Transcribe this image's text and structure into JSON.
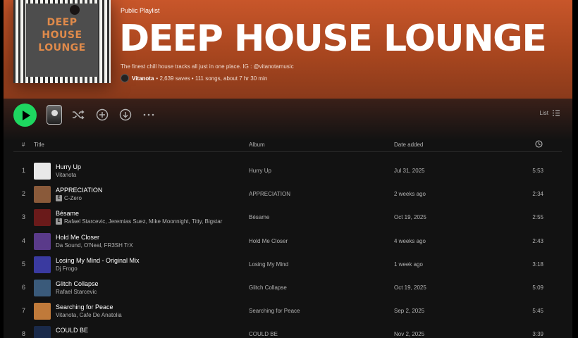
{
  "playlist": {
    "type_label": "Public Playlist",
    "title": "DEEP HOUSE LOUNGE",
    "description": "The finest chill house tracks all just in one place. IG : @vitanotamusic",
    "owner": "Vitanota",
    "stats": "• 2,639 saves • 111 songs, about 7 hr 30 min",
    "cover_lines": [
      "DEEP",
      "HOUSE",
      "LOUNGE"
    ]
  },
  "actions": {
    "view_label": "List"
  },
  "table": {
    "headers": {
      "index": "#",
      "title": "Title",
      "album": "Album",
      "date": "Date added"
    },
    "rows": [
      {
        "index": "1",
        "title": "Hurry Up",
        "artist": "Vitanota",
        "explicit": false,
        "album": "Hurry Up",
        "date": "Jul 31, 2025",
        "duration": "5:53",
        "thumb": "#e9e9e9"
      },
      {
        "index": "2",
        "title": "APPRECIATION",
        "artist": "C-Zero",
        "explicit": true,
        "album": "APPRECIATION",
        "date": "2 weeks ago",
        "duration": "2:34",
        "thumb": "#8a5a3a"
      },
      {
        "index": "3",
        "title": "Bésame",
        "artist": "Rafael Starcevic, Jeremias Suez, Mike Moonnight, Titty, Bigstar",
        "explicit": true,
        "album": "Bésame",
        "date": "Oct 19, 2025",
        "duration": "2:55",
        "thumb": "#6a1a1a"
      },
      {
        "index": "4",
        "title": "Hold Me Closer",
        "artist": "Da Sound, O'Neal, FR3SH TrX",
        "explicit": false,
        "album": "Hold Me Closer",
        "date": "4 weeks ago",
        "duration": "2:43",
        "thumb": "#5a3a8a"
      },
      {
        "index": "5",
        "title": "Losing My Mind - Original Mix",
        "artist": "Dj Frogo",
        "explicit": false,
        "album": "Losing My Mind",
        "date": "1 week ago",
        "duration": "3:18",
        "thumb": "#3a3aa0"
      },
      {
        "index": "6",
        "title": "Glitch Collapse",
        "artist": "Rafael Starcevic",
        "explicit": false,
        "album": "Glitch Collapse",
        "date": "Oct 19, 2025",
        "duration": "5:09",
        "thumb": "#3a5a7a"
      },
      {
        "index": "7",
        "title": "Searching for Peace",
        "artist": "Vitanota, Cafe De Anatolia",
        "explicit": false,
        "album": "Searching for Peace",
        "date": "Sep 2, 2025",
        "duration": "5:45",
        "thumb": "#c07a3a"
      },
      {
        "index": "8",
        "title": "COULD BE",
        "artist": "",
        "explicit": false,
        "album": "COULD BE",
        "date": "Nov 2, 2025",
        "duration": "3:39",
        "thumb": "#1a2a4a"
      }
    ]
  },
  "colors": {
    "accent": "#1ed760",
    "hero": "#c8562a",
    "background": "#121212"
  }
}
